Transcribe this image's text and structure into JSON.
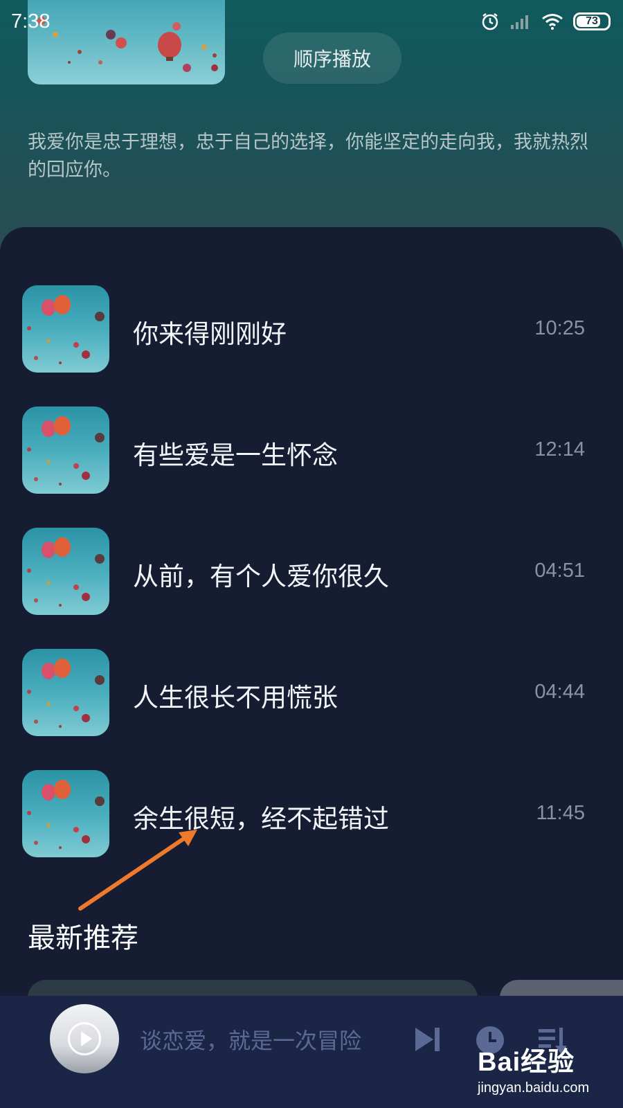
{
  "status_bar": {
    "time": "7:38",
    "battery": "73",
    "icons": [
      "alarm-icon",
      "signal-icon",
      "wifi-icon",
      "battery-icon"
    ]
  },
  "header": {
    "play_order_label": "顺序播放",
    "description": "我爱你是忠于理想，忠于自己的选择，你能坚定的走向我，我就热烈的回应你。"
  },
  "songs": [
    {
      "title": "你来得刚刚好",
      "duration": "10:25"
    },
    {
      "title": "有些爱是一生怀念",
      "duration": "12:14"
    },
    {
      "title": "从前，有个人爱你很久",
      "duration": "04:51"
    },
    {
      "title": "人生很长不用慌张",
      "duration": "04:44"
    },
    {
      "title": "余生很短，经不起错过",
      "duration": "11:45"
    }
  ],
  "annotation": {
    "label": "最新推荐",
    "arrow_color": "#f07a2c"
  },
  "player": {
    "now_playing": "谈恋爱，就是一次冒险",
    "icons": [
      "play-icon",
      "next-track-icon",
      "timer-icon",
      "playlist-icon"
    ]
  },
  "watermark": {
    "logo": "Bai经验",
    "url": "jingyan.baidu.com"
  },
  "colors": {
    "panel_bg": "#161d33",
    "player_bg": "#1b2647",
    "player_accent": "#5b6a95",
    "duration_text": "#8b92a7"
  }
}
